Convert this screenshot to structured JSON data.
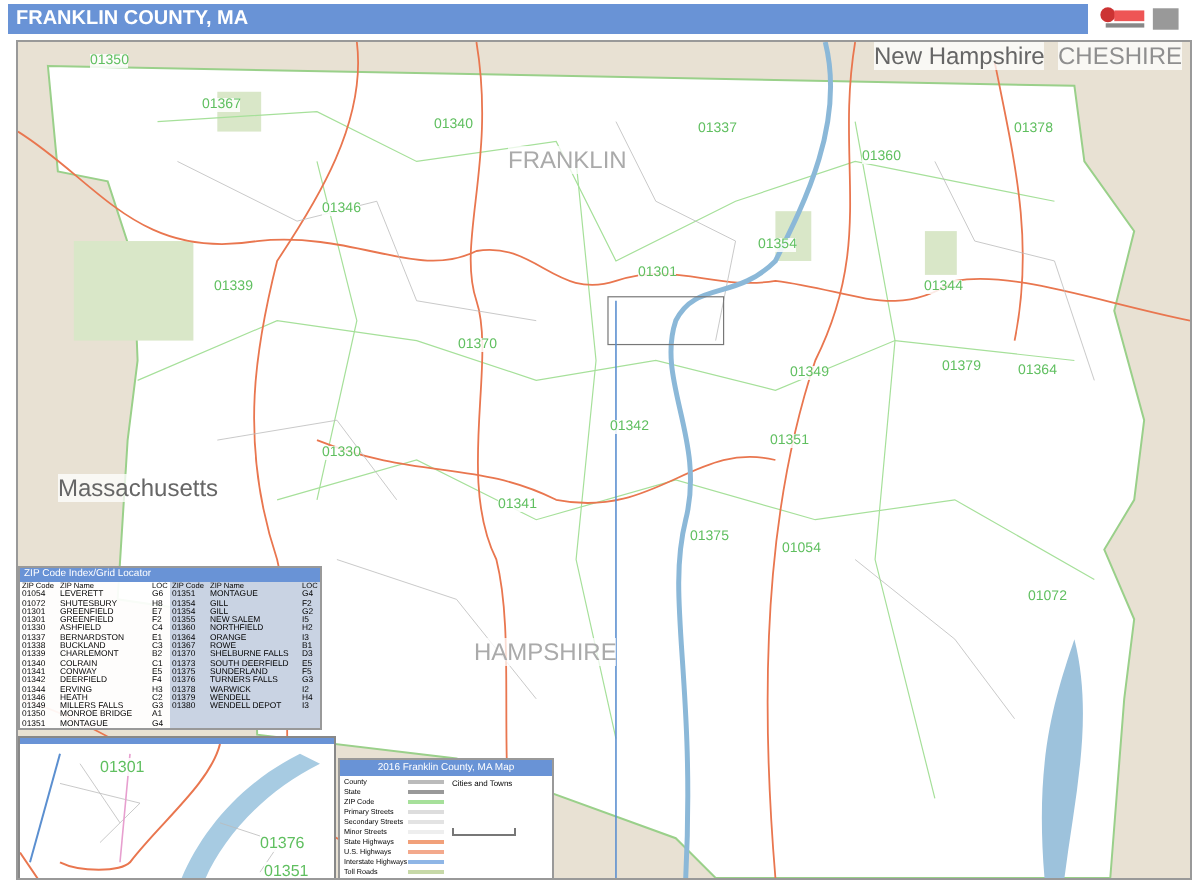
{
  "header": {
    "title": "FRANKLIN COUNTY, MA"
  },
  "map": {
    "region_labels": [
      {
        "text": "New Hampshire",
        "kind": "state"
      },
      {
        "text": "CHESHIRE",
        "kind": "county"
      },
      {
        "text": "FRANKLIN",
        "kind": "county"
      },
      {
        "text": "Massachusetts",
        "kind": "state"
      },
      {
        "text": "HAMPSHIRE",
        "kind": "county"
      }
    ],
    "zip_labels": [
      "01350",
      "01367",
      "01340",
      "01337",
      "01360",
      "01378",
      "01346",
      "01354",
      "01339",
      "01301",
      "01344",
      "01370",
      "01349",
      "01379",
      "01364",
      "01342",
      "01351",
      "01330",
      "01341",
      "01375",
      "01054",
      "01072"
    ]
  },
  "zip_index": {
    "title": "ZIP Code Index/Grid Locator",
    "left": {
      "columns": [
        "ZIP Code",
        "ZIP Name",
        "LOC"
      ],
      "rows": [
        [
          "01054",
          "LEVERETT",
          "G6"
        ],
        [
          "01072",
          "SHUTESBURY",
          "H8"
        ],
        [
          "01301",
          "GREENFIELD",
          "E7"
        ],
        [
          "01301",
          "GREENFIELD",
          "F2"
        ],
        [
          "01330",
          "ASHFIELD",
          "C4"
        ],
        [
          "01337",
          "BERNARDSTON",
          "E1"
        ],
        [
          "01338",
          "BUCKLAND",
          "C3"
        ],
        [
          "01339",
          "CHARLEMONT",
          "B2"
        ],
        [
          "01340",
          "COLRAIN",
          "C1"
        ],
        [
          "01341",
          "CONWAY",
          "E5"
        ],
        [
          "01342",
          "DEERFIELD",
          "F4"
        ],
        [
          "01344",
          "ERVING",
          "H3"
        ],
        [
          "01346",
          "HEATH",
          "C2"
        ],
        [
          "01349",
          "MILLERS FALLS",
          "G3"
        ],
        [
          "01350",
          "MONROE BRIDGE",
          "A1"
        ],
        [
          "01351",
          "MONTAGUE",
          "G4"
        ]
      ]
    },
    "right": {
      "columns": [
        "ZIP Code",
        "ZIP Name",
        "LOC"
      ],
      "rows": [
        [
          "01351",
          "MONTAGUE",
          "G4"
        ],
        [
          "01354",
          "GILL",
          "F2"
        ],
        [
          "01354",
          "GILL",
          "G2"
        ],
        [
          "01355",
          "NEW SALEM",
          "I5"
        ],
        [
          "01360",
          "NORTHFIELD",
          "H2"
        ],
        [
          "01364",
          "ORANGE",
          "I3"
        ],
        [
          "01367",
          "ROWE",
          "B1"
        ],
        [
          "01370",
          "SHELBURNE FALLS",
          "D3"
        ],
        [
          "01373",
          "SOUTH DEERFIELD",
          "E5"
        ],
        [
          "01375",
          "SUNDERLAND",
          "F5"
        ],
        [
          "01376",
          "TURNERS FALLS",
          "G3"
        ],
        [
          "01378",
          "WARWICK",
          "I2"
        ],
        [
          "01379",
          "WENDELL",
          "H4"
        ],
        [
          "01380",
          "WENDELL DEPOT",
          "I3"
        ]
      ]
    }
  },
  "inset": {
    "zip_labels": [
      "01301",
      "01376",
      "01351"
    ]
  },
  "legend": {
    "title": "2016 Franklin County, MA Map",
    "items": [
      {
        "label": "County",
        "kind": "county"
      },
      {
        "label": "State",
        "kind": "state"
      },
      {
        "label": "ZIP Code",
        "kind": "zip"
      },
      {
        "label": "Primary Streets",
        "kind": "primary"
      },
      {
        "label": "Secondary Streets",
        "kind": "secondary"
      },
      {
        "label": "Minor Streets",
        "kind": "minor"
      },
      {
        "label": "State Highways",
        "kind": "state_hwy"
      },
      {
        "label": "U.S. Highways",
        "kind": "us_hwy"
      },
      {
        "label": "Interstate Highways",
        "kind": "interstate"
      },
      {
        "label": "Toll Roads",
        "kind": "toll"
      }
    ],
    "towns_heading": "Cities and Towns"
  }
}
